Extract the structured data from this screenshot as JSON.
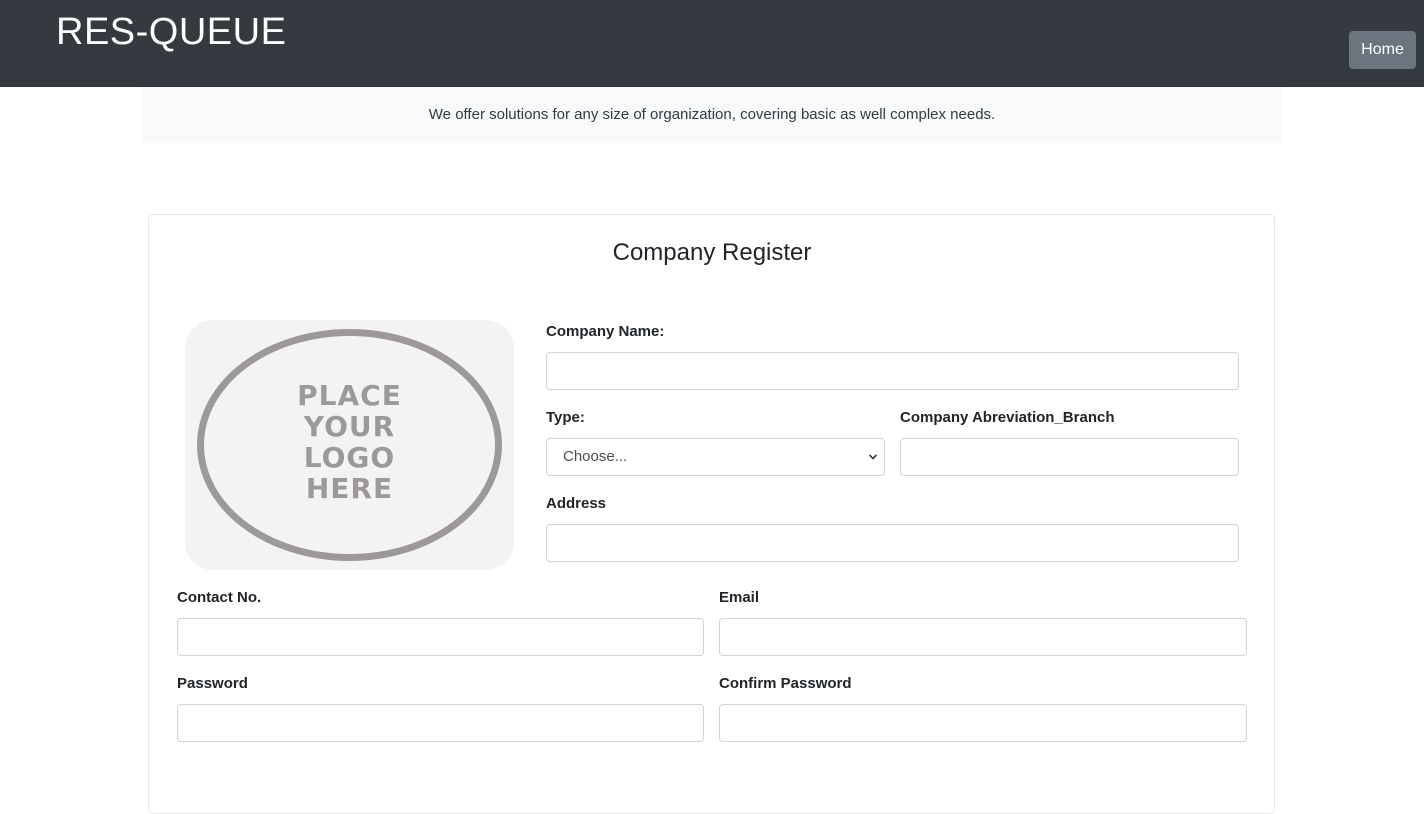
{
  "navbar": {
    "brand": "RES-QUEUE",
    "home_label": "Home"
  },
  "banner": {
    "text": "We offer solutions for any size of organization, covering basic as well complex needs."
  },
  "form": {
    "title": "Company Register",
    "logo_placeholder": {
      "line1": "PLACE",
      "line2": "YOUR",
      "line3": "LOGO",
      "line4": "HERE"
    },
    "company_name": {
      "label": "Company Name:",
      "value": ""
    },
    "type": {
      "label": "Type:",
      "selected": "Choose..."
    },
    "abbreviation": {
      "label": "Company Abreviation_Branch",
      "value": ""
    },
    "address": {
      "label": "Address",
      "value": ""
    },
    "contact": {
      "label": "Contact No.",
      "value": ""
    },
    "email": {
      "label": "Email",
      "value": ""
    },
    "password": {
      "label": "Password",
      "value": ""
    },
    "confirm_password": {
      "label": "Confirm Password",
      "value": ""
    }
  }
}
